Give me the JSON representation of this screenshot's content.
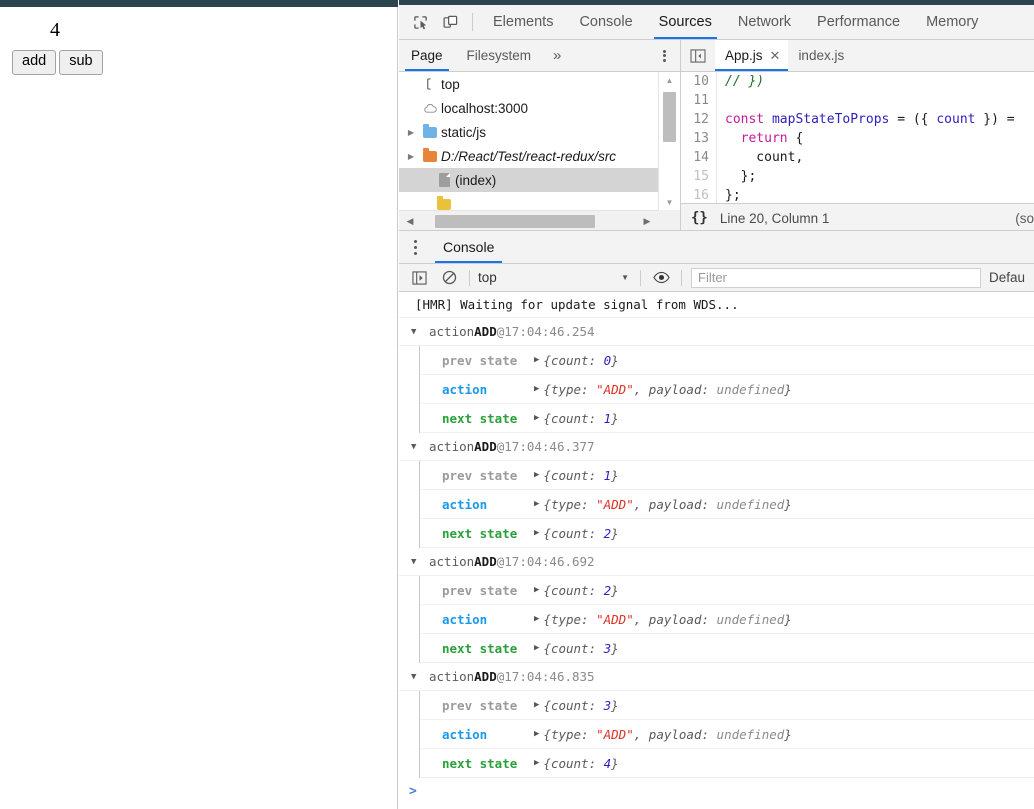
{
  "page": {
    "counter_value": "4",
    "buttons": [
      {
        "label": "add",
        "name": "add-button"
      },
      {
        "label": "sub",
        "name": "sub-button"
      }
    ]
  },
  "devtools": {
    "main_tabs": [
      {
        "label": "Elements",
        "selected": false
      },
      {
        "label": "Console",
        "selected": false
      },
      {
        "label": "Sources",
        "selected": true
      },
      {
        "label": "Network",
        "selected": false
      },
      {
        "label": "Performance",
        "selected": false
      },
      {
        "label": "Memory",
        "selected": false
      }
    ],
    "toolbar_icons": [
      "inspect-element-icon",
      "device-toolbar-icon"
    ],
    "navigator": {
      "tabs": [
        {
          "label": "Page",
          "selected": true
        },
        {
          "label": "Filesystem",
          "selected": false
        }
      ],
      "more_tabs_label": "»",
      "tree": [
        {
          "label": "top",
          "indent": 0,
          "arrow": "",
          "icon": "frame-icon",
          "color": "#666666",
          "italic": false,
          "selected": false
        },
        {
          "label": "localhost:3000",
          "indent": 0,
          "arrow": "",
          "icon": "cloud-icon",
          "color": "#888888",
          "italic": false,
          "selected": false
        },
        {
          "label": "static/js",
          "indent": 0,
          "arrow": "▶",
          "icon": "folder-icon",
          "color": "#6fb2e8",
          "italic": false,
          "selected": false
        },
        {
          "label": "D:/React/Test/react-redux/src",
          "indent": 0,
          "arrow": "▶",
          "icon": "folder-icon",
          "color": "#e8833a",
          "italic": true,
          "selected": false
        },
        {
          "label": "(index)",
          "indent": 1,
          "arrow": "",
          "icon": "document-icon",
          "color": "#9e9e9e",
          "italic": false,
          "selected": true
        }
      ]
    },
    "editor": {
      "tabs": [
        {
          "label": "App.js",
          "selected": true,
          "closable": true
        },
        {
          "label": "index.js",
          "selected": false,
          "closable": false
        }
      ],
      "lines": [
        {
          "no": "10",
          "dim": false,
          "tokens": [
            {
              "t": "// })",
              "c": "com"
            }
          ]
        },
        {
          "no": "11",
          "dim": false,
          "tokens": []
        },
        {
          "no": "12",
          "dim": false,
          "tokens": [
            {
              "t": "const ",
              "c": "key"
            },
            {
              "t": "mapStateToProps",
              "c": "var"
            },
            {
              "t": " = ({ ",
              "c": "pln"
            },
            {
              "t": "count",
              "c": "var"
            },
            {
              "t": " }) =",
              "c": "pln"
            }
          ]
        },
        {
          "no": "13",
          "dim": false,
          "tokens": [
            {
              "t": "  ",
              "c": "pln"
            },
            {
              "t": "return",
              "c": "key"
            },
            {
              "t": " {",
              "c": "pln"
            }
          ]
        },
        {
          "no": "14",
          "dim": false,
          "tokens": [
            {
              "t": "    count,",
              "c": "pln"
            }
          ]
        },
        {
          "no": "15",
          "dim": true,
          "tokens": [
            {
              "t": "  };",
              "c": "pln"
            }
          ]
        },
        {
          "no": "16",
          "dim": true,
          "tokens": [
            {
              "t": "};",
              "c": "pln"
            }
          ]
        }
      ],
      "status": {
        "format_icon": "{}",
        "position": "Line 20, Column 1",
        "tail": "(so"
      }
    },
    "drawer": {
      "tabs": [
        {
          "label": "Console",
          "selected": true
        }
      ],
      "console_toolbar": {
        "icons": [
          "execution-sidebar-icon",
          "clear-console-icon",
          "eye-icon"
        ],
        "context": "top",
        "filter_placeholder": "Filter",
        "level_label": "Defau"
      },
      "console": {
        "plain_messages": [
          "[HMR] Waiting for update signal from WDS..."
        ],
        "groups": [
          {
            "prefix": "action ",
            "action": "ADD",
            "at": " @ ",
            "timestamp": "17:04:46.254",
            "rows": [
              {
                "name": "prev state",
                "kind": "prev",
                "value_pre": "{count: ",
                "value_num": "0",
                "value_post": "}"
              },
              {
                "name": "action",
                "kind": "actn",
                "value_pre": "{type: ",
                "value_str": "\"ADD\"",
                "value_mid": ", payload: ",
                "value_und": "undefined",
                "value_post": "}"
              },
              {
                "name": "next state",
                "kind": "next",
                "value_pre": "{count: ",
                "value_num": "1",
                "value_post": "}"
              }
            ]
          },
          {
            "prefix": "action ",
            "action": "ADD",
            "at": " @ ",
            "timestamp": "17:04:46.377",
            "rows": [
              {
                "name": "prev state",
                "kind": "prev",
                "value_pre": "{count: ",
                "value_num": "1",
                "value_post": "}"
              },
              {
                "name": "action",
                "kind": "actn",
                "value_pre": "{type: ",
                "value_str": "\"ADD\"",
                "value_mid": ", payload: ",
                "value_und": "undefined",
                "value_post": "}"
              },
              {
                "name": "next state",
                "kind": "next",
                "value_pre": "{count: ",
                "value_num": "2",
                "value_post": "}"
              }
            ]
          },
          {
            "prefix": "action ",
            "action": "ADD",
            "at": " @ ",
            "timestamp": "17:04:46.692",
            "rows": [
              {
                "name": "prev state",
                "kind": "prev",
                "value_pre": "{count: ",
                "value_num": "2",
                "value_post": "}"
              },
              {
                "name": "action",
                "kind": "actn",
                "value_pre": "{type: ",
                "value_str": "\"ADD\"",
                "value_mid": ", payload: ",
                "value_und": "undefined",
                "value_post": "}"
              },
              {
                "name": "next state",
                "kind": "next",
                "value_pre": "{count: ",
                "value_num": "3",
                "value_post": "}"
              }
            ]
          },
          {
            "prefix": "action ",
            "action": "ADD",
            "at": " @ ",
            "timestamp": "17:04:46.835",
            "rows": [
              {
                "name": "prev state",
                "kind": "prev",
                "value_pre": "{count: ",
                "value_num": "3",
                "value_post": "}"
              },
              {
                "name": "action",
                "kind": "actn",
                "value_pre": "{type: ",
                "value_str": "\"ADD\"",
                "value_mid": ", payload: ",
                "value_und": "undefined",
                "value_post": "}"
              },
              {
                "name": "next state",
                "kind": "next",
                "value_pre": "{count: ",
                "value_num": "4",
                "value_post": "}"
              }
            ]
          }
        ],
        "prompt": ">"
      }
    }
  }
}
